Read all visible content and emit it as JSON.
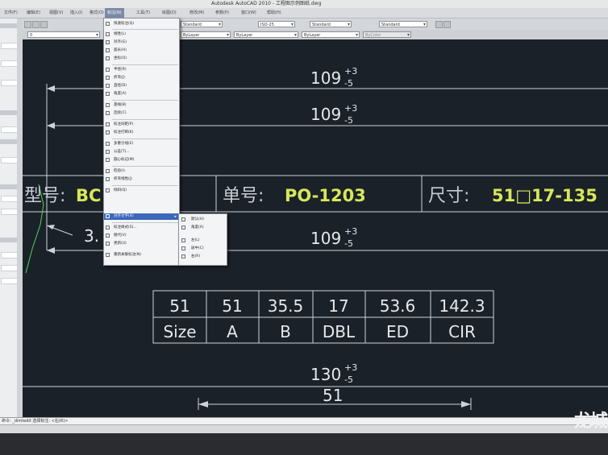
{
  "window": {
    "title": "Autodesk AutoCAD 2010 - 工程图示例图纸.dwg"
  },
  "menu_bar": [
    "文件(F)",
    "编辑(E)",
    "视图(V)",
    "插入(I)",
    "格式(O)",
    "工具(T)",
    "绘图(D)",
    "标注(N)",
    "修改(M)",
    "参数(P)",
    "窗口(W)",
    "帮助(H)"
  ],
  "menu_bar_active": "标注(N)",
  "toolbars": {
    "workspace": "AutoCAD 经典",
    "text_style": "Standard",
    "dim_style": "ISO-25",
    "table_style": "Standard",
    "multileader_style": "Standard",
    "layer": "0",
    "color": "ByLayer",
    "linetype": "ByLayer",
    "lineweight": "ByLayer",
    "plotstyle": "ByColor"
  },
  "dim_menu": {
    "items": [
      "快速标注(Q)",
      "线性(L)",
      "对齐(G)",
      "弧长(H)",
      "坐标(O)",
      "半径(R)",
      "折弯(J)",
      "直径(D)",
      "角度(A)",
      "基线(B)",
      "连续(C)",
      "标注间距(P)",
      "标注打断(K)",
      "多重引线(E)",
      "公差(T)...",
      "圆心标记(M)",
      "检验(I)",
      "折弯线性(J)",
      "倾斜(Q)",
      "对齐文字(X)",
      "标注样式(S)...",
      "替代(V)",
      "更新(U)",
      "重新关联标注(N)"
    ],
    "highlighted": "对齐文字(X)"
  },
  "sub_menu": {
    "items": [
      "默认(H)",
      "角度(A)",
      "左(L)",
      "居中(C)",
      "右(R)"
    ]
  },
  "drawing": {
    "dims": [
      {
        "base": "109",
        "upper": "+3",
        "lower": "-5"
      },
      {
        "base": "109",
        "upper": "+3",
        "lower": "-5"
      },
      {
        "base": "109",
        "upper": "+3",
        "lower": "-5"
      },
      {
        "base": "130",
        "upper": "+3",
        "lower": "-5"
      }
    ],
    "dim_51": "51",
    "dim_partial": "3.",
    "header": {
      "model_label": "型号:",
      "model_value": "BC",
      "order_label": "单号:",
      "order_value": "PO-1203",
      "size_label": "尺寸:",
      "size_value": "51□17-135"
    },
    "table": {
      "values": [
        "51",
        "51",
        "35.5",
        "17",
        "53.6",
        "142.3"
      ],
      "headers": [
        "Size",
        "A",
        "B",
        "DBL",
        "ED",
        "CIR"
      ]
    }
  },
  "command_line": "命令: _dimtedit 选择标注: <右(R)>",
  "watermark": "龙城",
  "colors": {
    "canvas": "#1b2129",
    "line": "#cfd3d8",
    "highlight_text": "#d6e85a",
    "menu_highlight": "#3d67b8"
  }
}
